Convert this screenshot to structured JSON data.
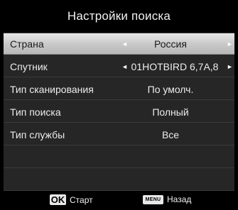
{
  "header": {
    "title": "Настройки поиска"
  },
  "rows": [
    {
      "label": "Страна",
      "value": "Россия"
    },
    {
      "label": "Спутник",
      "value": "01HOTBIRD 6,7A,8"
    },
    {
      "label": "Тип сканирования",
      "value": "По умолч."
    },
    {
      "label": "Тип поиска",
      "value": "Полный"
    },
    {
      "label": "Тип службы",
      "value": "Все"
    }
  ],
  "arrows": {
    "left": "◄",
    "right": "►"
  },
  "footer": {
    "ok_key": "OK",
    "ok_label": "Старт",
    "menu_key": "MENU",
    "menu_label": "Назад"
  },
  "colors": {
    "background": "#000000",
    "panel": "#262626",
    "selected_row": "#c9c9c9"
  }
}
